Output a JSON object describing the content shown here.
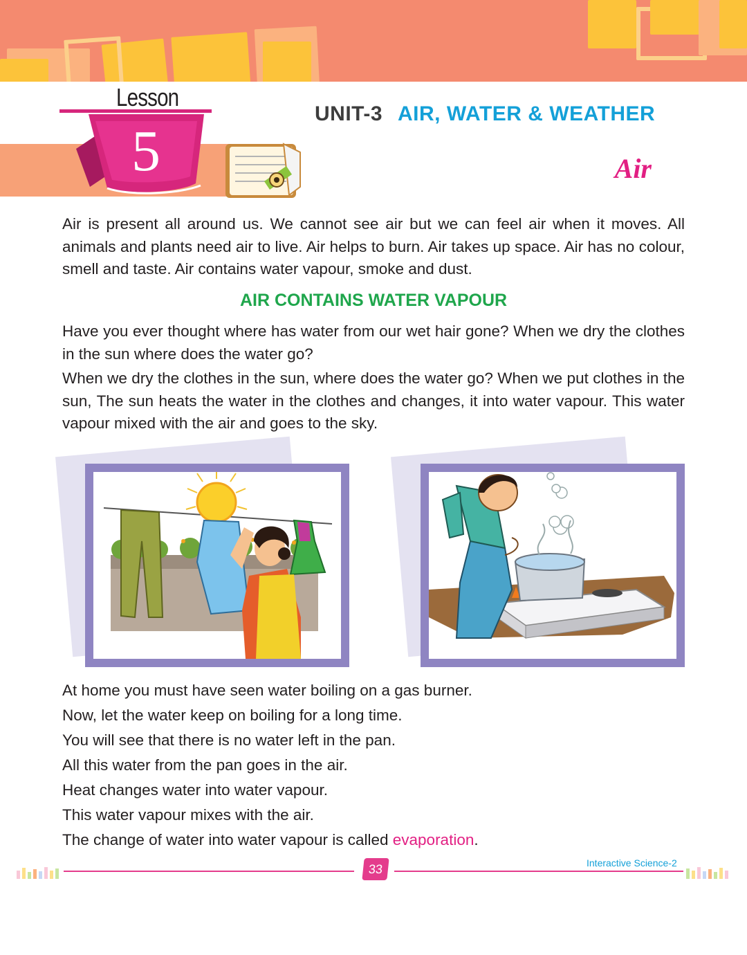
{
  "lesson": {
    "word": "Lesson",
    "number": "5"
  },
  "unit": {
    "label": "UNIT-3",
    "title": "AIR, WATER & WEATHER"
  },
  "topic_title": "Air",
  "intro_paragraph": "Air is present all around us. We cannot see air but we can feel air when it moves. All animals and plants need air to live. Air helps to burn. Air takes up space. Air has no colour, smell and taste. Air contains water vapour, smoke and dust.",
  "section_heading": "AIR CONTAINS WATER VAPOUR",
  "paragraph_2": "Have you ever thought where has water from our wet hair gone? When we dry the clothes in the sun where does the water go?",
  "paragraph_3": "When we dry the clothes in the sun, where does the water go? When we put clothes in the sun, The sun heats the water in the clothes and changes, it into water vapour. This water vapour mixed with the air and goes to the sky.",
  "lines": [
    "At home you must have seen water boiling on a gas burner.",
    "Now, let the water keep on boiling for a long time.",
    "You will see that there is no water left in the pan.",
    "All this water from the pan goes in the air.",
    "Heat changes water into water vapour.",
    "This water vapour mixes with the air."
  ],
  "last_line": {
    "before": "The change of water into water vapour is called ",
    "highlight": "evaporation",
    "after": "."
  },
  "footer": {
    "page_number": "33",
    "book_title": "Interactive Science-2"
  },
  "colors": {
    "accent_pink": "#e21f83",
    "heading_green": "#1fa64c",
    "unit_blue": "#14a0d8",
    "frame_purple": "#8f85c2",
    "banner": "#f48a6f"
  }
}
